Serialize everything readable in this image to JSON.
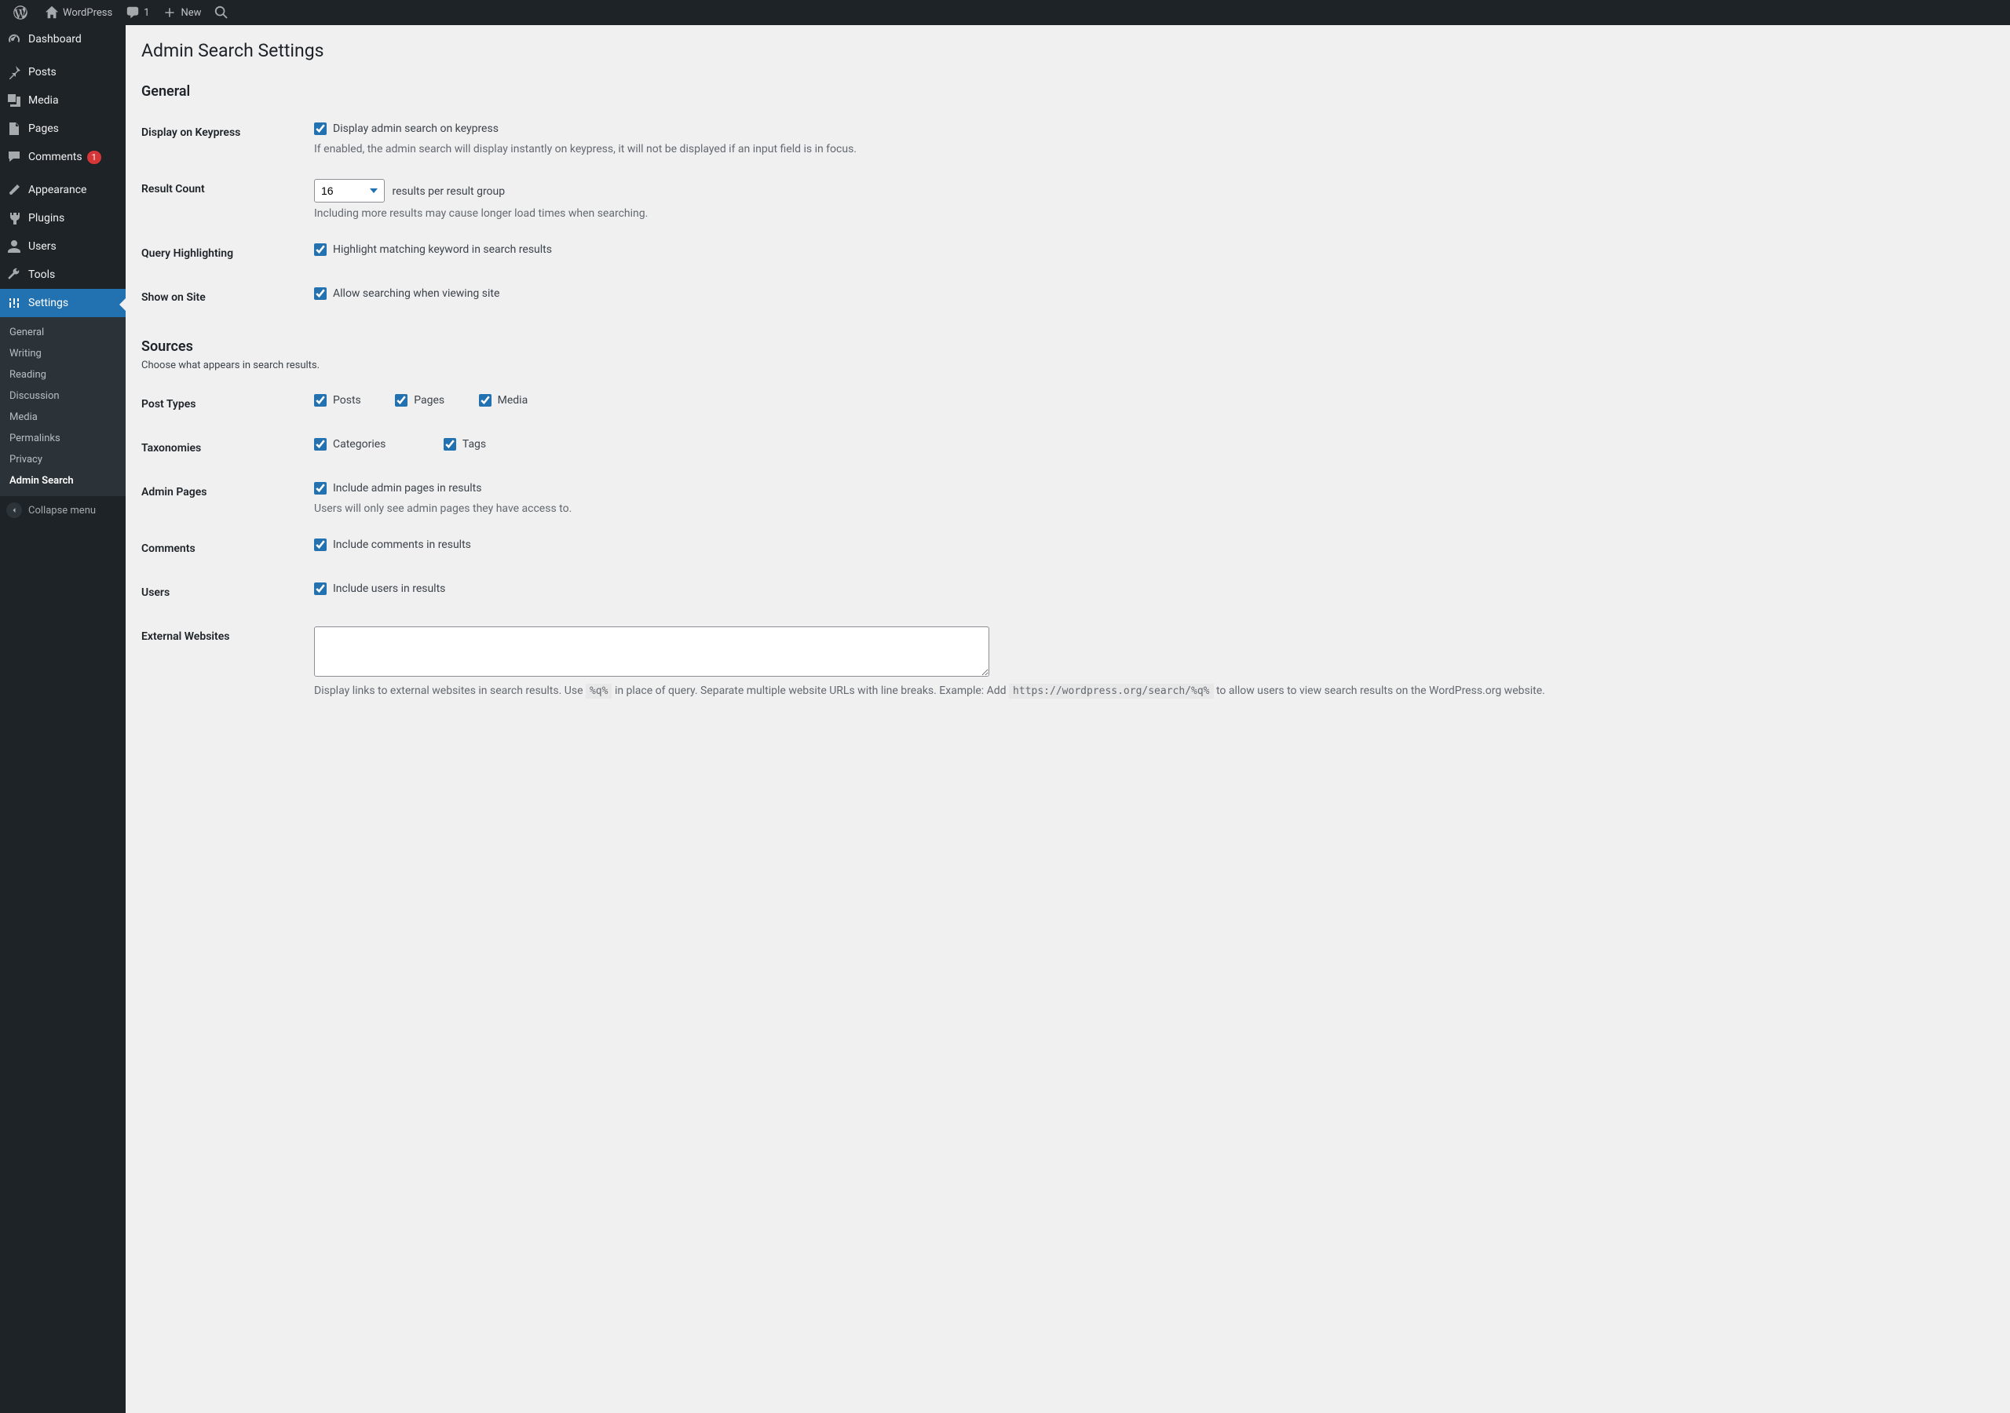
{
  "adminbar": {
    "site_name": "WordPress",
    "comment_count": "1",
    "new_label": "New"
  },
  "sidebar": {
    "items": [
      {
        "label": "Dashboard"
      },
      {
        "label": "Posts"
      },
      {
        "label": "Media"
      },
      {
        "label": "Pages"
      },
      {
        "label": "Comments",
        "badge": "1"
      },
      {
        "label": "Appearance"
      },
      {
        "label": "Plugins"
      },
      {
        "label": "Users"
      },
      {
        "label": "Tools"
      },
      {
        "label": "Settings"
      }
    ],
    "settings_submenu": [
      "General",
      "Writing",
      "Reading",
      "Discussion",
      "Media",
      "Permalinks",
      "Privacy",
      "Admin Search"
    ],
    "collapse_label": "Collapse menu"
  },
  "page": {
    "title": "Admin Search Settings",
    "general_heading": "General",
    "display_on_keypress": {
      "th": "Display on Keypress",
      "cb": "Display admin search on keypress",
      "desc": "If enabled, the admin search will display instantly on keypress, it will not be displayed if an input field is in focus."
    },
    "result_count": {
      "th": "Result Count",
      "value": "16",
      "suffix": "results per result group",
      "desc": "Including more results may cause longer load times when searching."
    },
    "query_highlighting": {
      "th": "Query Highlighting",
      "cb": "Highlight matching keyword in search results"
    },
    "show_on_site": {
      "th": "Show on Site",
      "cb": "Allow searching when viewing site"
    },
    "sources_heading": "Sources",
    "sources_sub": "Choose what appears in search results.",
    "post_types": {
      "th": "Post Types",
      "options": [
        "Posts",
        "Pages",
        "Media"
      ]
    },
    "taxonomies": {
      "th": "Taxonomies",
      "options": [
        "Categories",
        "Tags"
      ]
    },
    "admin_pages": {
      "th": "Admin Pages",
      "cb": "Include admin pages in results",
      "desc": "Users will only see admin pages they have access to."
    },
    "comments": {
      "th": "Comments",
      "cb": "Include comments in results"
    },
    "users": {
      "th": "Users",
      "cb": "Include users in results"
    },
    "external": {
      "th": "External Websites",
      "value": "",
      "desc_pre": "Display links to external websites in search results. Use ",
      "token": "%q%",
      "desc_mid": " in place of query. Separate multiple website URLs with line breaks. Example: Add ",
      "example": "https://wordpress.org/search/%q%",
      "desc_post": " to allow users to view search results on the WordPress.org website."
    }
  }
}
